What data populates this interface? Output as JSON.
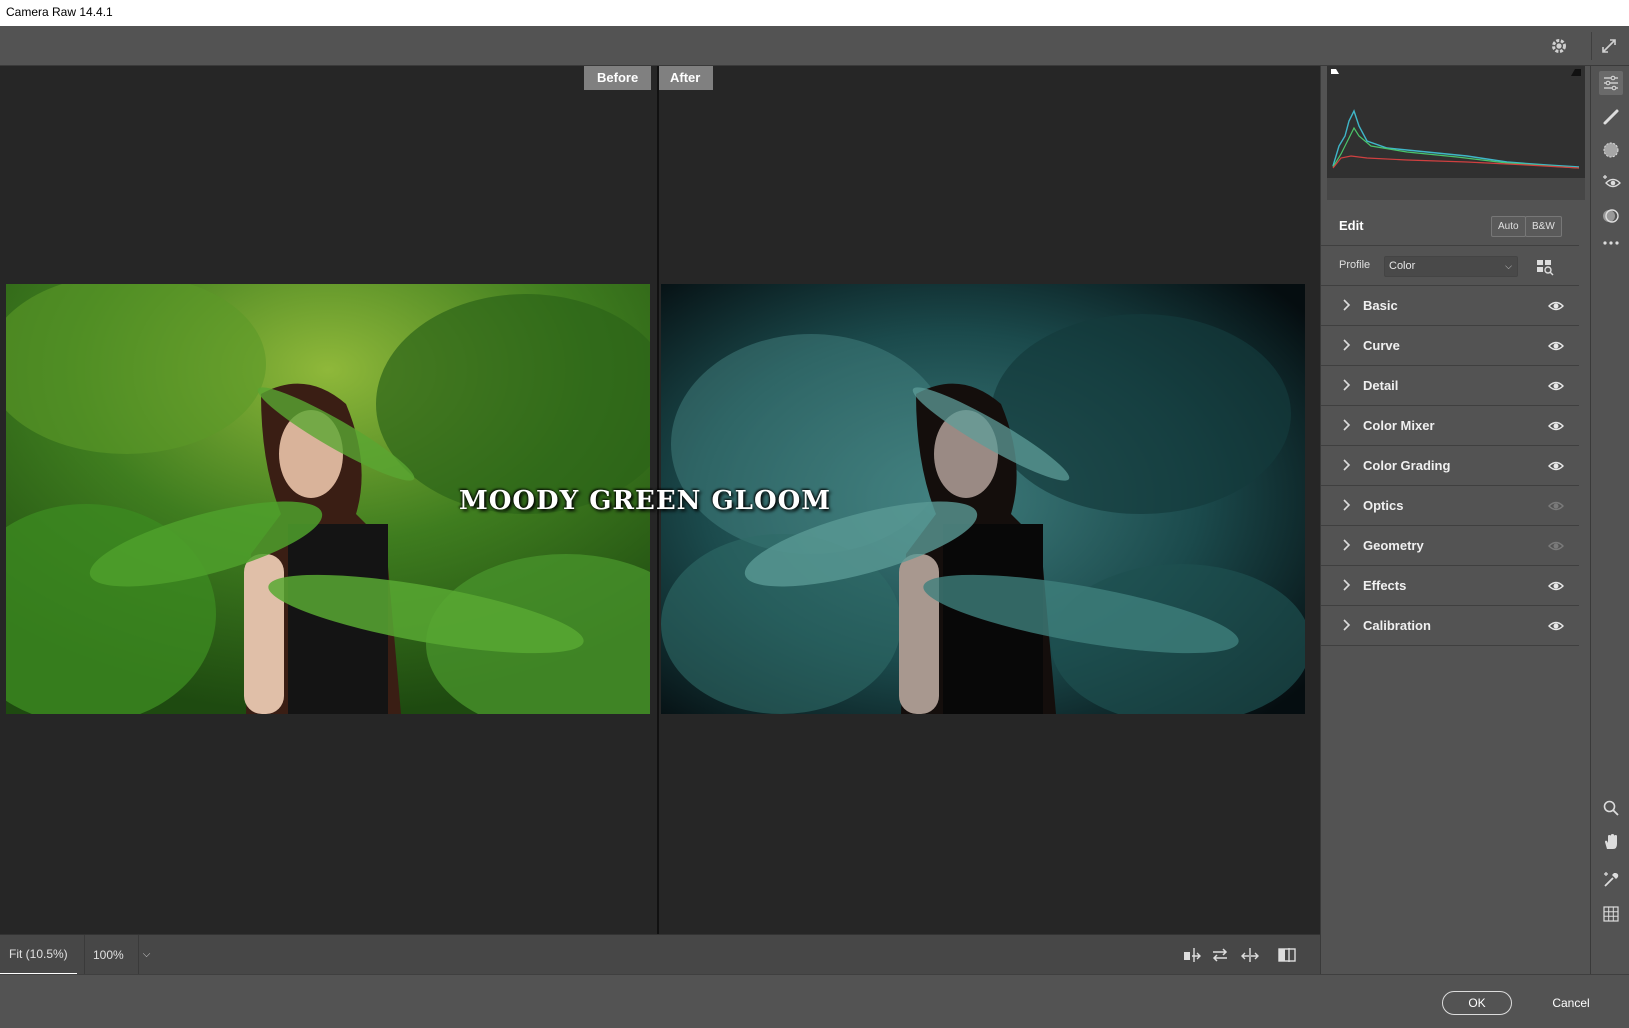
{
  "window": {
    "title": "Camera Raw 14.4.1"
  },
  "viewer": {
    "before_label": "Before",
    "after_label": "After",
    "overlay_title": "MOODY GREEN GLOOM"
  },
  "bottombar": {
    "zoom_fit": "Fit (10.5%)",
    "zoom_percent": "100%"
  },
  "panel": {
    "edit_title": "Edit",
    "auto_label": "Auto",
    "bw_label": "B&W",
    "profile_label": "Profile",
    "profile_value": "Color",
    "sections": [
      {
        "label": "Basic",
        "visible": true
      },
      {
        "label": "Curve",
        "visible": true
      },
      {
        "label": "Detail",
        "visible": true
      },
      {
        "label": "Color Mixer",
        "visible": true
      },
      {
        "label": "Color Grading",
        "visible": true
      },
      {
        "label": "Optics",
        "visible": false
      },
      {
        "label": "Geometry",
        "visible": false
      },
      {
        "label": "Effects",
        "visible": true
      },
      {
        "label": "Calibration",
        "visible": true
      }
    ]
  },
  "footer": {
    "ok_label": "OK",
    "cancel_label": "Cancel"
  },
  "colors": {
    "eye_active": "#e8e8e8",
    "eye_inactive": "#7a7a7a",
    "histogram_blue": "#3fb6c8",
    "histogram_green": "#4ac46a",
    "histogram_red": "#d04040"
  },
  "icons": {
    "topbar": [
      "gear-icon",
      "fullscreen-icon"
    ],
    "tools_top": [
      "edit-sliders-icon",
      "healing-icon",
      "masking-icon",
      "redeye-icon",
      "presets-icon",
      "more-icon"
    ],
    "tools_bottom": [
      "zoom-icon",
      "hand-icon",
      "color-sampler-icon",
      "grid-icon"
    ],
    "bottombar": [
      "swap-before-after-icon",
      "swap-settings-icon",
      "copy-settings-icon",
      "view-mode-icon"
    ]
  }
}
